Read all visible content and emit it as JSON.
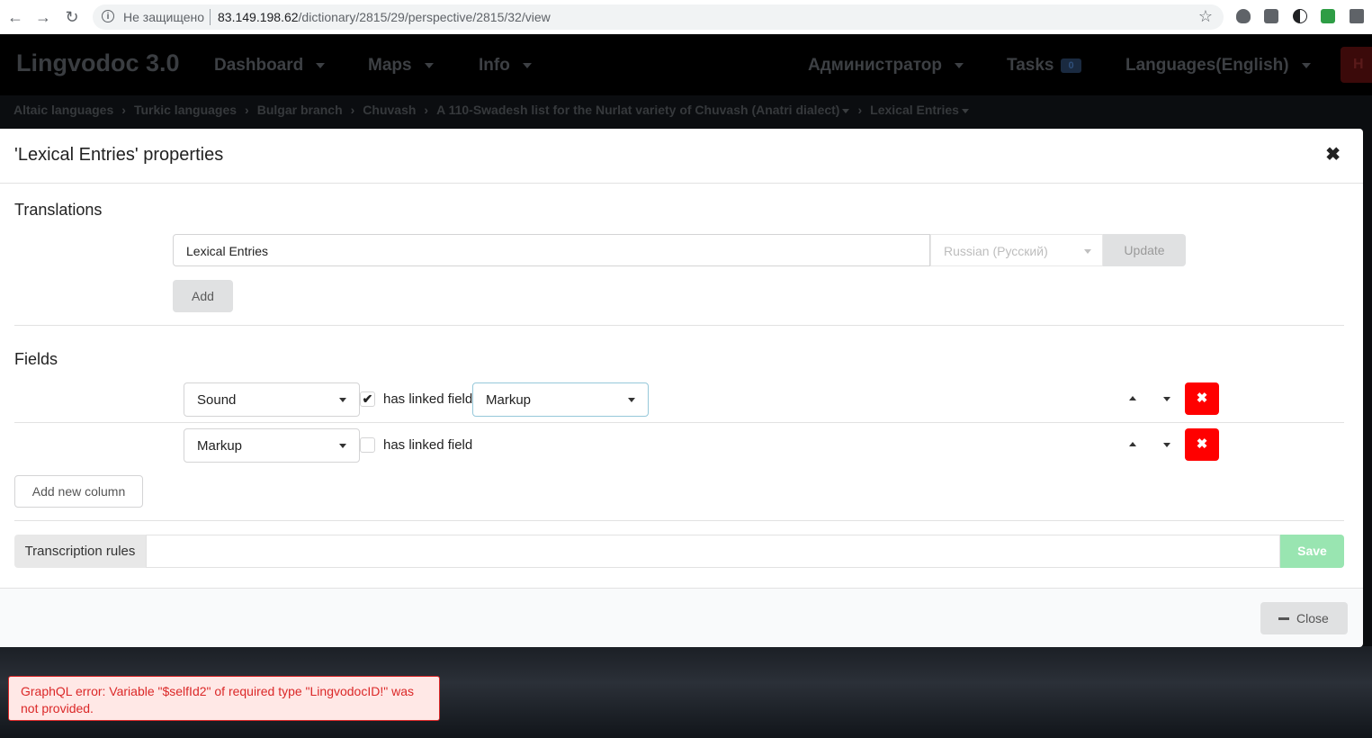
{
  "browser": {
    "insecure_label": "Не защищено",
    "url_host": "83.149.198.62",
    "url_path": "/dictionary/2815/29/perspective/2815/32/view"
  },
  "header": {
    "logo": "Lingvodoc 3.0",
    "menus": [
      "Dashboard",
      "Maps",
      "Info"
    ],
    "user": "Администратор",
    "tasks_label": "Tasks",
    "tasks_count": "0",
    "languages": "Languages(English)"
  },
  "breadcrumb": [
    "Altaic languages",
    "Turkic languages",
    "Bulgar branch",
    "Chuvash",
    "A 110-Swadesh list for the Nurlat variety of Chuvash (Anatri dialect)",
    "Lexical Entries"
  ],
  "modal": {
    "title": "'Lexical Entries' properties",
    "translations": {
      "section_title": "Translations",
      "value": "Lexical Entries",
      "language": "Russian (Русский)",
      "update_label": "Update",
      "add_label": "Add"
    },
    "fields": {
      "section_title": "Fields",
      "rows": [
        {
          "field": "Sound",
          "checked": true,
          "checkbox_label": "has linked field",
          "linked": "Markup"
        },
        {
          "field": "Markup",
          "checked": false,
          "checkbox_label": "has linked field"
        }
      ],
      "add_column_label": "Add new column"
    },
    "transcription": {
      "label": "Transcription rules",
      "value": "",
      "save_label": "Save"
    },
    "close_label": "Close"
  },
  "error": {
    "message": "GraphQL error: Variable \"$selfId2\" of required type \"LingvodocID!\" was not provided."
  },
  "colors": {
    "danger": "#ff0000",
    "save": "#99e5b1",
    "error_text": "#db2828"
  }
}
